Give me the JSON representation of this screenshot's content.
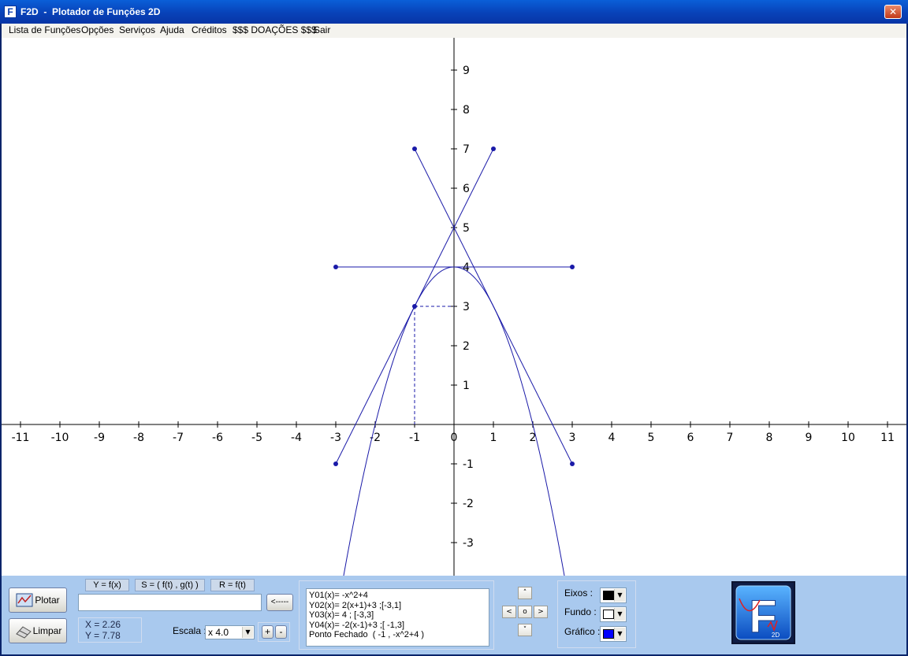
{
  "window": {
    "app_icon_letter": "F",
    "title": "F2D  -  Plotador de Funções 2D",
    "close_glyph": "✕"
  },
  "menu": [
    "Lista de Funções",
    "Opções",
    "Serviços",
    "Ajuda",
    "Créditos",
    "$$$ DOAÇÕES $$$",
    "Sair"
  ],
  "plot": {
    "x_range": [
      -11.5,
      11.5
    ],
    "y_range": [
      -3.8,
      9.8
    ],
    "x_ticks": [
      -11,
      -10,
      -9,
      -8,
      -7,
      -6,
      -5,
      -4,
      -3,
      -2,
      -1,
      0,
      1,
      2,
      3,
      4,
      5,
      6,
      7,
      8,
      9,
      10,
      11
    ],
    "y_ticks": [
      -3,
      -2,
      -1,
      1,
      2,
      3,
      4,
      5,
      6,
      7,
      8,
      9
    ],
    "axis_color": "#000000",
    "background_color": "#ffffff",
    "graph_color": "#1a1aa8",
    "functions": [
      {
        "expr": "-x^2+4"
      },
      {
        "expr": "2(x+1)+3",
        "domain": [
          -3,
          1
        ]
      },
      {
        "expr": "4",
        "domain": [
          -3,
          3
        ]
      },
      {
        "expr": "-2(x-1)+3",
        "domain": [
          -1,
          3
        ]
      }
    ],
    "closed_point": {
      "x": -1,
      "y": 3
    }
  },
  "controls": {
    "plot_button": "Plotar",
    "clear_button": "Limpar",
    "mode_tabs": [
      "Y = f(x)",
      "S = ( f(t) , g(t) )",
      "R = f(t)"
    ],
    "input_value": "",
    "insert_button": "<-----",
    "coord_x": "X =  2.26",
    "coord_y": "Y =  7.78",
    "scale_label": "Escala :",
    "scale_value": "x 4.0",
    "zoom_in": "+",
    "zoom_out": "-"
  },
  "function_list": [
    "Y01(x)= -x^2+4",
    "Y02(x)= 2(x+1)+3 ;[-3,1]",
    "Y03(x)= 4 ; [-3,3]",
    "Y04(x)= -2(x-1)+3 ;[ -1,3]",
    "Ponto Fechado  ( -1 , -x^2+4 )"
  ],
  "pan": {
    "up": "˄",
    "down": "˅",
    "left": "<",
    "right": ">",
    "center": "o"
  },
  "colors": {
    "axes_label": "Eixos   :",
    "axes_color": "#000000",
    "background_label": "Fundo  :",
    "background_color": "#ffffff",
    "graph_label": "Gráfico :",
    "graph_color": "#0000ff"
  },
  "logo": {
    "letter": "F",
    "caption": "2D"
  }
}
